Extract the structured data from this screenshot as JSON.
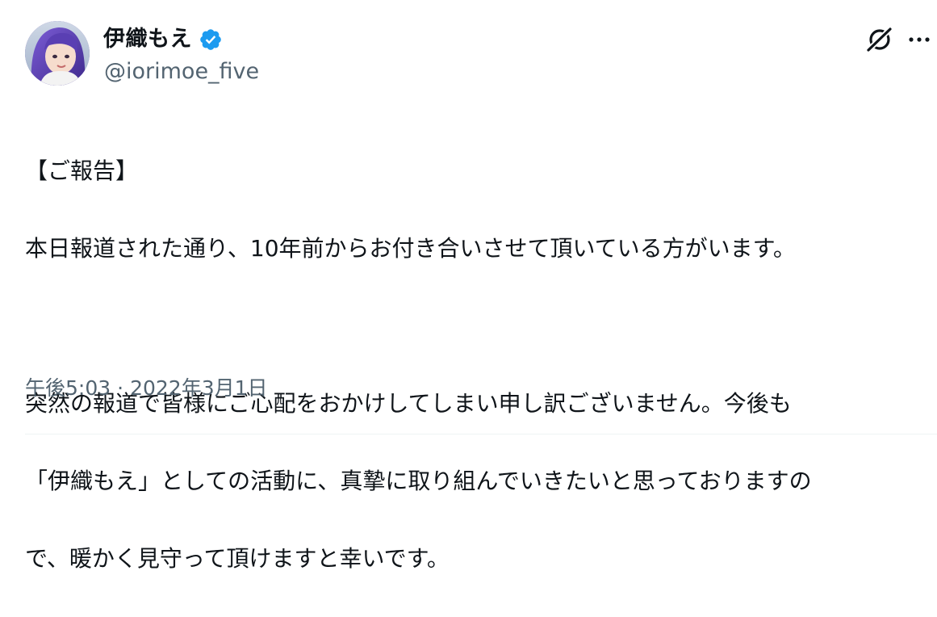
{
  "author": {
    "display_name": "伊織もえ",
    "handle": "@iorimoe_five",
    "verified": true,
    "verified_color": "#1d9bf0",
    "avatar_icon": "avatar-photo"
  },
  "actions": {
    "grok_icon": "grok-icon",
    "more_icon": "more-icon"
  },
  "tweet": {
    "lines": [
      "【ご報告】",
      "本日報道された通り、10年前からお付き合いさせて頂いている方がいます。",
      "",
      "突然の報道で皆様にご心配をおかけしてしまい申し訳ございません。今後も",
      "「伊織もえ」としての活動に、真摯に取り組んでいきたいと思っておりますの",
      "で、暖かく見守って頂けますと幸いです。"
    ]
  },
  "meta": {
    "time": "午後5:03",
    "separator": "·",
    "date": "2022年3月1日"
  },
  "colors": {
    "text": "#0f1419",
    "secondary": "#536471",
    "accent": "#1d9bf0",
    "divider": "#eff3f4"
  }
}
